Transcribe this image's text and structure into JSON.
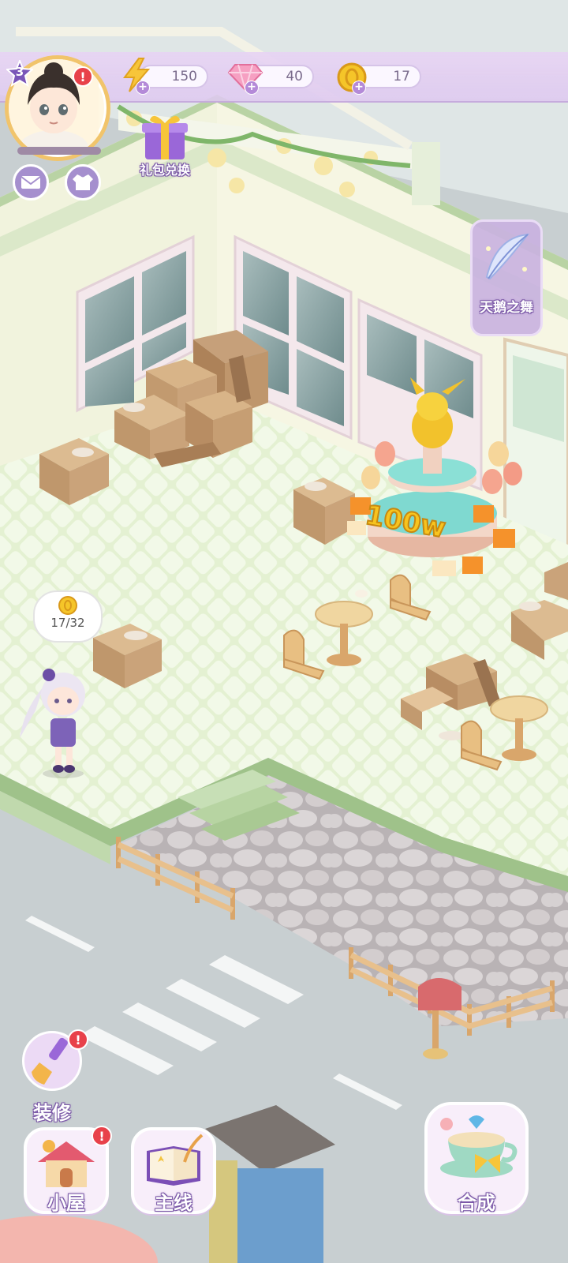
{
  "hud": {
    "level": "3",
    "energy": {
      "icon": "lightning-icon",
      "value": "150"
    },
    "gems": {
      "icon": "gem-icon",
      "value": "40"
    },
    "coins": {
      "icon": "coin-icon",
      "value": "17"
    },
    "notification_mark": "!"
  },
  "buttons": {
    "gift_redeem": "礼包兑换",
    "swan_dance": "天鹅之舞",
    "decorate": "装修",
    "cottage": "小屋",
    "main_quest": "主线",
    "merge": "合成"
  },
  "scene": {
    "coin_bubble": "17/32",
    "fountain_sign": "100w"
  },
  "colors": {
    "hud_bar": "#e4d0f2",
    "accent_purple": "#a58fce",
    "notification_red": "#e8414a",
    "floor_green": "#e3f0d2",
    "wall_cream": "#f6f6e4",
    "box_brown": "#c9a47a"
  }
}
